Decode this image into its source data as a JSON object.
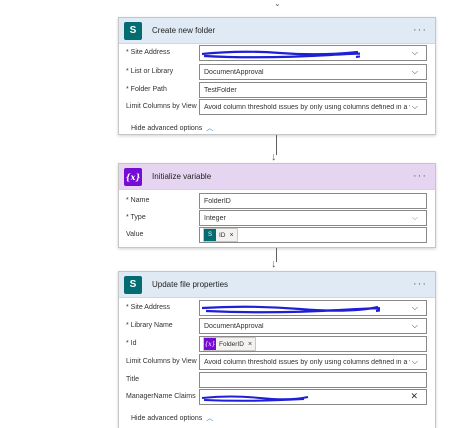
{
  "top_chevron": "⌄",
  "create_folder": {
    "title": "Create new folder",
    "more": "···",
    "site_address_label": "* Site Address",
    "library_label": "* List or Library",
    "library_value": "DocumentApproval",
    "folder_path_label": "* Folder Path",
    "folder_path_value": "TestFolder",
    "limit_label": "Limit Columns by View",
    "limit_value": "Avoid column threshold issues by only using columns defined in a view.",
    "advanced_label": "Hide advanced options"
  },
  "init_variable": {
    "title": "Initialize variable",
    "icon_text": "{x}",
    "more": "···",
    "name_label": "* Name",
    "name_value": "FolderID",
    "type_label": "* Type",
    "type_value": "Integer",
    "value_label": "Value",
    "token_label": "ID"
  },
  "update_props": {
    "title": "Update file properties",
    "more": "···",
    "site_address_label": "* Site Address",
    "library_label": "* Library Name",
    "library_value": "DocumentApproval",
    "id_label": "* Id",
    "id_token_icon": "{x}",
    "id_token_label": "FolderID",
    "limit_label": "Limit Columns by View",
    "limit_value": "Avoid column threshold issues by only using columns defined in a view",
    "title_label": "Title",
    "manager_label": "ManagerName Claims",
    "advanced_label": "Hide advanced options"
  },
  "colors": {
    "sharepoint": "#036c70",
    "variable": "#770bd6",
    "redaction": "#1f1fd6",
    "link": "#0078d4"
  }
}
